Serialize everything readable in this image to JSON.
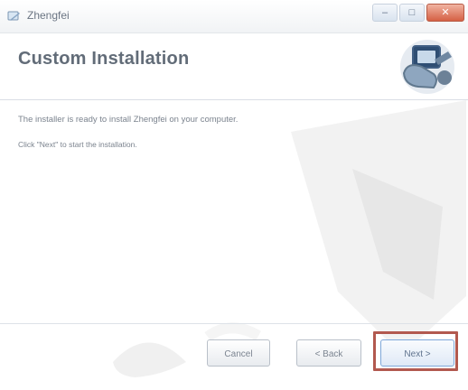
{
  "window": {
    "title": "Zhengfei",
    "minimize_label": "–",
    "maximize_label": "□",
    "close_label": "✕"
  },
  "header": {
    "heading": "Custom Installation"
  },
  "content": {
    "line1": "The installer is ready to install Zhengfei on your computer.",
    "line2": "Click \"Next\" to start the installation."
  },
  "buttons": {
    "cancel": "Cancel",
    "back": "< Back",
    "next": "Next >"
  },
  "icons": {
    "app": "installer-app-icon",
    "header_graphic": "computer-installer-icon",
    "background": "faded-shield-watermark"
  },
  "colors": {
    "heading": "#626c78",
    "highlight": "#b2594f",
    "close_button": "#d56044"
  }
}
